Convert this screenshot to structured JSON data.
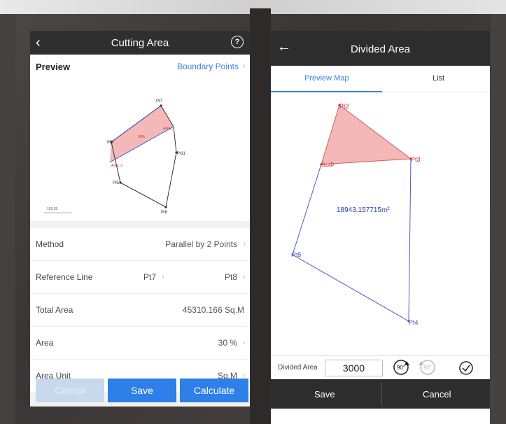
{
  "left": {
    "header": {
      "title": "Cutting Area",
      "back_icon": "chevron-left-icon",
      "help_icon": "help-circle-icon"
    },
    "preview": {
      "title": "Preview",
      "link": "Boundary Points",
      "labels": {
        "pt7": "Pt7",
        "pt9": "Pt9",
        "pt11": "Pt11",
        "pt5": "Pt5",
        "pt8": "Pt8",
        "area1": "Area_1",
        "area2": "Area_2",
        "pct": "30%",
        "scale": "103.39"
      }
    },
    "rows": {
      "method": {
        "label": "Method",
        "value": "Parallel by 2 Points"
      },
      "reference": {
        "label": "Reference Line",
        "from": "Pt7",
        "to": "Pt8"
      },
      "total": {
        "label": "Total Area",
        "value": "45310.166 Sq.M"
      },
      "area": {
        "label": "Area",
        "value": "30 %"
      },
      "unit": {
        "label": "Area Unit",
        "value": "Sq.M"
      }
    },
    "buttons": {
      "cancel": "Cancel",
      "save": "Save",
      "calculate": "Calculate"
    },
    "colors": {
      "accent": "#2f7fe8",
      "fill": "#f5b8b8"
    }
  },
  "right": {
    "header": {
      "title": "Divided Area",
      "back_icon": "arrow-left-icon"
    },
    "tabs": {
      "preview": "Preview Map",
      "list": "List"
    },
    "map": {
      "pt2": "Pt2",
      "pt3": "Pt3",
      "solp": "SolP",
      "pt5": "Pt5",
      "pt4": "Pt4",
      "area_value": "18943.157715m²"
    },
    "control": {
      "label": "Divided Area",
      "value": "3000",
      "rot_cw": "90°",
      "rot_ccw": "90°",
      "confirm_icon": "check-circle-icon"
    },
    "footer": {
      "save": "Save",
      "cancel": "Cancel"
    }
  }
}
